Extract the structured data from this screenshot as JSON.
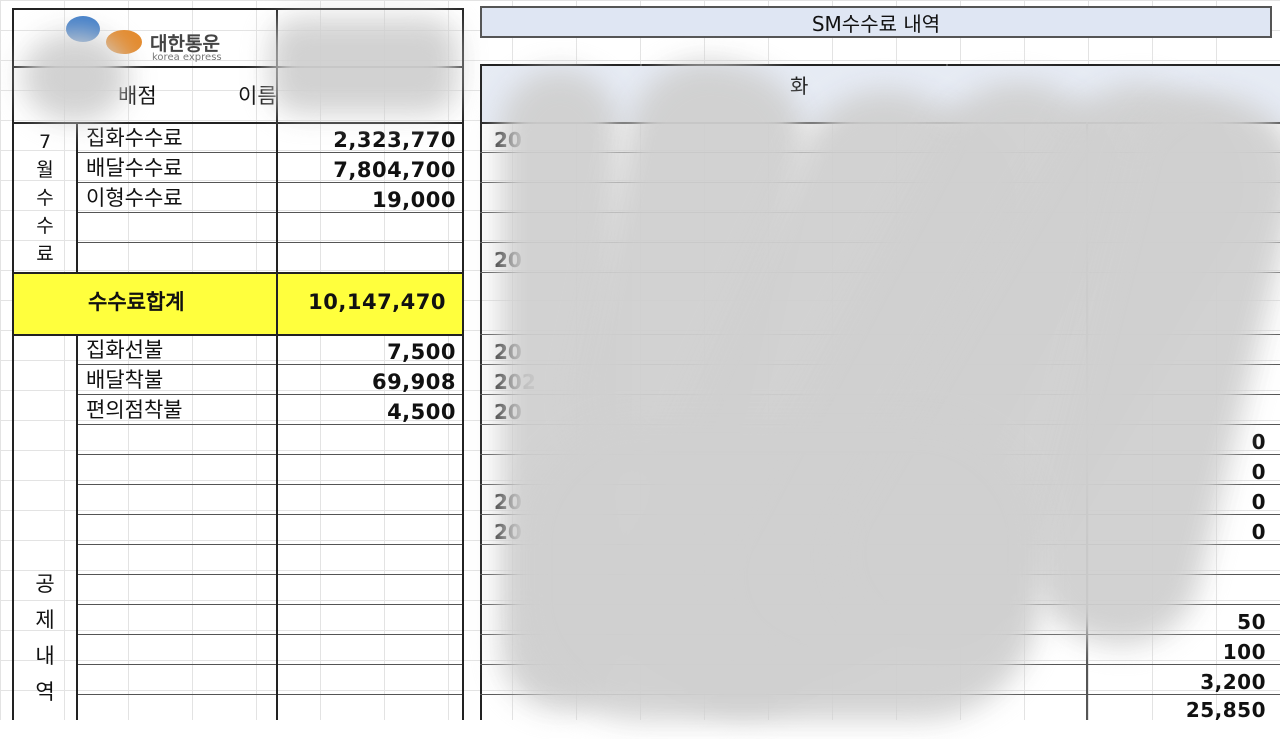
{
  "company": {
    "name": "대한통운",
    "subtitle": "korea express"
  },
  "header": {
    "branch_label": "배점",
    "name_label": "이름"
  },
  "panel_title": "SM수수료 내역",
  "panel_header_partial": "화",
  "month_label": [
    "7",
    "월",
    "수",
    "수",
    "료"
  ],
  "fees": [
    {
      "label": "집화수수료",
      "value": "2,323,770"
    },
    {
      "label": "배달수수료",
      "value": "7,804,700"
    },
    {
      "label": "이형수수료",
      "value": "19,000"
    }
  ],
  "total": {
    "label": "수수료합계",
    "value": "10,147,470"
  },
  "deduction_label": [
    "공",
    "제",
    "내",
    "역"
  ],
  "deductions": [
    {
      "label": "집화선불",
      "value": "7,500"
    },
    {
      "label": "배달착불",
      "value": "69,908"
    },
    {
      "label": "편의점착불",
      "value": "4,500"
    }
  ],
  "right_fragments": [
    {
      "text": "20"
    },
    {
      "text": "20"
    },
    {
      "text": "20"
    },
    {
      "text": "202"
    },
    {
      "text": "20"
    },
    {
      "text": "20"
    },
    {
      "text": "20"
    }
  ],
  "right_values": [
    "0",
    "0",
    "0",
    "0",
    "50",
    "100",
    "3,200",
    "25,850"
  ],
  "colors": {
    "highlight": "#ffff3d",
    "header_fill": "#dfe6f3",
    "logo_blue": "#3d7cc9",
    "logo_orange": "#e48a2c"
  }
}
